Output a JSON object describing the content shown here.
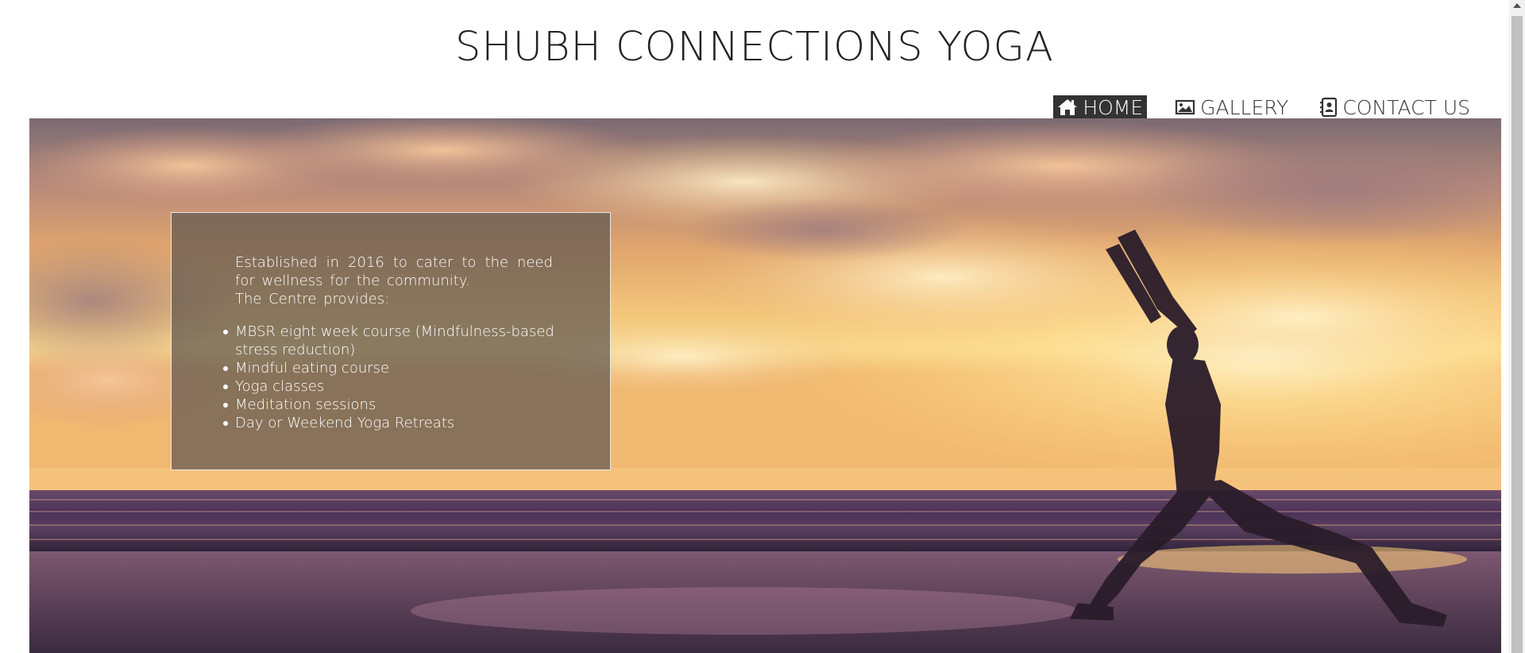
{
  "site": {
    "title": "SHUBH CONNECTIONS YOGA"
  },
  "nav": {
    "items": [
      {
        "label": "HOME",
        "icon": "home-icon",
        "active": true
      },
      {
        "label": "GALLERY",
        "icon": "image-icon",
        "active": false
      },
      {
        "label": "CONTACT US",
        "icon": "contact-card-icon",
        "active": false
      }
    ]
  },
  "hero": {
    "intro_line1": "Established in 2016 to cater to the need for wellness for the community.",
    "intro_line2": "The Centre provides:",
    "services": [
      "MBSR eight week course (Mindfulness-based stress reduction)",
      "Mindful eating course",
      "Yoga classes",
      "Meditation sessions",
      "Day or Weekend Yoga Retreats"
    ]
  },
  "colors": {
    "nav_active_bg": "#333333",
    "title_text": "#222222",
    "info_box_bg": "rgba(95,88,80,0.72)"
  }
}
